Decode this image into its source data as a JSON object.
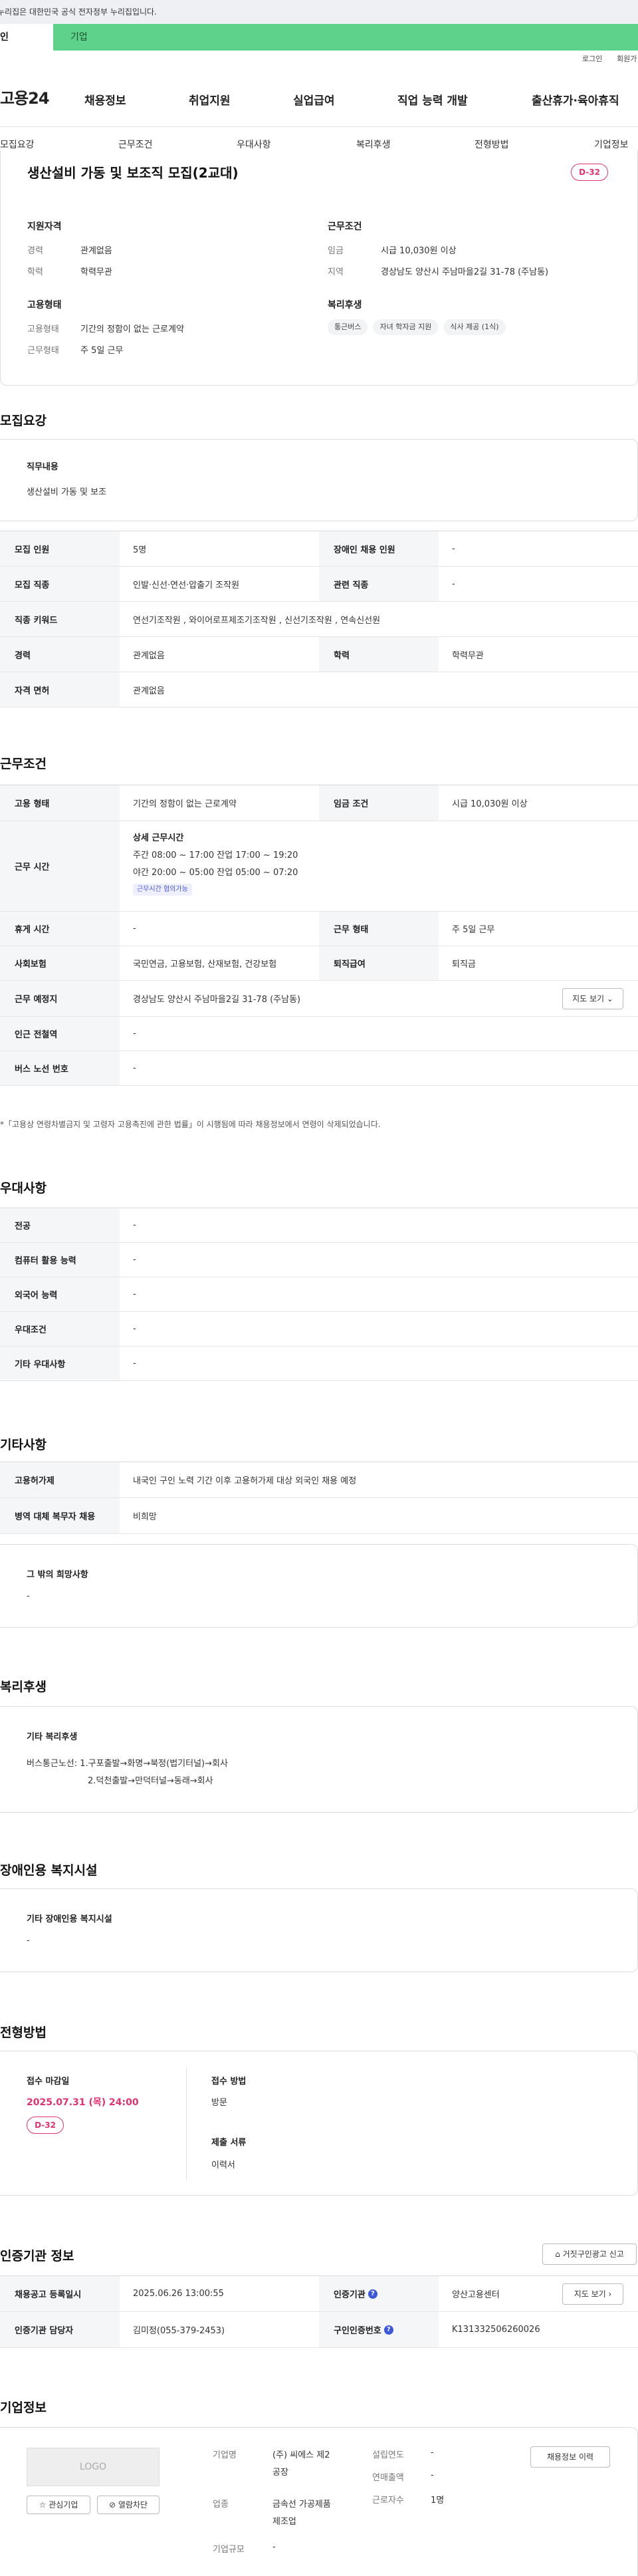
{
  "topbar": {
    "notice": "누리집은 대한민국 공식 전자정부 누리집입니다."
  },
  "tabs": {
    "individual": "인",
    "business": "기업"
  },
  "util": {
    "login": "로그인",
    "join": "회원가"
  },
  "header": {
    "logo": "고용24",
    "gnb": [
      "채용정보",
      "취업지원",
      "실업급여",
      "직업 능력 개발",
      "출산휴가·육아휴직"
    ]
  },
  "subnav": [
    "모집요강",
    "근무조건",
    "우대사항",
    "복리후생",
    "전형방법",
    "기업정보"
  ],
  "summary": {
    "title": "생산설비 가동 및 보조직 모집(2교대)",
    "dday": "D-32",
    "qual_title": "지원자격",
    "career_k": "경력",
    "career_v": "관계없음",
    "edu_k": "학력",
    "edu_v": "학력무관",
    "emptype_title": "고용형태",
    "emptype_k": "고용형태",
    "emptype_v": "기간의 정함이 없는 근로계약",
    "worktype_k": "근무형태",
    "worktype_v": "주 5일 근무",
    "cond_title": "근무조건",
    "wage_k": "임금",
    "wage_v": "시급 10,030원 이상",
    "region_k": "지역",
    "region_v": "경상남도 양산시 주남마을2길 31-78 (주남동)",
    "welfare_title": "복리후생",
    "chips": [
      "통근버스",
      "자녀 학자금 지원",
      "식사 제공 (1식)"
    ]
  },
  "recruit": {
    "section": "모집요강",
    "duty_title": "직무내용",
    "duty_text": "생산설비 가동 및 보조",
    "rows": {
      "count_k": "모집 인원",
      "count_v": "5명",
      "disabled_k": "장애인 채용 인원",
      "disabled_v": "-",
      "job_k": "모집 직종",
      "job_v": "인발·신선·연선·압출기 조작원",
      "related_k": "관련 직종",
      "related_v": "-",
      "kw_k": "직종 키워드",
      "kw_v": "연선기조작원 , 와이어로프제조기조작원 , 신선기조작원 , 연속신선원",
      "career_k": "경력",
      "career_v": "관계없음",
      "edu_k": "학력",
      "edu_v": "학력무관",
      "license_k": "자격 면허",
      "license_v": "관계없음"
    }
  },
  "work": {
    "section": "근무조건",
    "emptype_k": "고용 형태",
    "emptype_v": "기간의 정함이 없는 근로계약",
    "wage_k": "임금 조건",
    "wage_v": "시급 10,030원 이상",
    "hours_k": "근무 시간",
    "hours_title": "상세 근무시간",
    "hours_day": "주간 08:00 ~ 17:00 잔업 17:00 ~ 19:20",
    "hours_night": "야간 20:00 ~ 05:00 잔업 05:00 ~ 07:20",
    "hours_badge": "근무시간 협의가능",
    "break_k": "휴게 시간",
    "break_v": "-",
    "worktype_k": "근무 형태",
    "worktype_v": "주 5일 근무",
    "insurance_k": "사회보험",
    "insurance_v": "국민연금, 고용보험, 산재보험, 건강보험",
    "severance_k": "퇴직급여",
    "severance_v": "퇴직금",
    "place_k": "근무 예정지",
    "place_v": "경상남도 양산시 주남마을2길 31-78 (주남동)",
    "map_btn": "지도 보기 ⌄",
    "subway_k": "인근 전철역",
    "subway_v": "-",
    "bus_k": "버스 노선 번호",
    "bus_v": "-",
    "note": "*「고용상 연령차별금지 및 고령자 고용촉진에 관한 법률」이 시행됨에 따라 채용정보에서 연령이 삭제되었습니다."
  },
  "pref": {
    "section": "우대사항",
    "rows": [
      {
        "k": "전공",
        "v": "-"
      },
      {
        "k": "컴퓨터 활용 능력",
        "v": "-"
      },
      {
        "k": "외국어 능력",
        "v": "-"
      },
      {
        "k": "우대조건",
        "v": "-"
      },
      {
        "k": "기타 우대사항",
        "v": "-"
      }
    ]
  },
  "etc": {
    "section": "기타사항",
    "foreign_k": "고용허가제",
    "foreign_v": "내국인 구인 노력 기간 이후 고용허가제 대상 외국인 채용 예정",
    "military_k": "병역 대체 복무자 채용",
    "military_v": "비희망",
    "other_title": "그 밖의 희망사항",
    "other_v": "-"
  },
  "welfare": {
    "section": "복리후생",
    "box_title": "기타 복리후생",
    "line1": "버스통근노선: 1.구포출발→화명→북정(법기터널)→회사",
    "line2": "2.덕천출발→만덕터널→동래→회사"
  },
  "disabled_fac": {
    "section": "장애인용 복지시설",
    "box_title": "기타 장애인용 복지시설",
    "v": "-"
  },
  "selection": {
    "section": "전형방법",
    "deadline_title": "접수 마감일",
    "deadline_v": "2025.07.31 (목) 24:00",
    "dday": "D-32",
    "method_title": "접수 방법",
    "method_v": "방문",
    "docs_title": "제출 서류",
    "docs_v": "이력서"
  },
  "cert": {
    "section": "인증기관 정보",
    "report_btn": "거짓구인광고 신고",
    "reg_k": "채용공고 등록일시",
    "reg_v": "2025.06.26 13:00:55",
    "org_k": "인증기관",
    "org_v": "양산고용센터",
    "map_btn": "지도 보기 ›",
    "mgr_k": "인증기관 담당자",
    "mgr_v": "김미정(055-379-2453)",
    "num_k": "구인인증번호",
    "num_v": "K131332506260026"
  },
  "company": {
    "section": "기업정보",
    "logo": "LOGO",
    "fav_btn": "관심기업",
    "block_btn": "열람차단",
    "name_k": "기업명",
    "name_v1": "(주) 씨에스 제2",
    "name_v2": "공장",
    "ind_k": "업종",
    "ind_v1": "금속선 가공제품",
    "ind_v2": "제조업",
    "size_k": "기업규모",
    "size_v": "-",
    "est_k": "설립연도",
    "est_v": "-",
    "sales_k": "연매출액",
    "sales_v": "-",
    "emp_k": "근로자수",
    "emp_v": "1명",
    "history_btn": "채용정보 이력"
  }
}
